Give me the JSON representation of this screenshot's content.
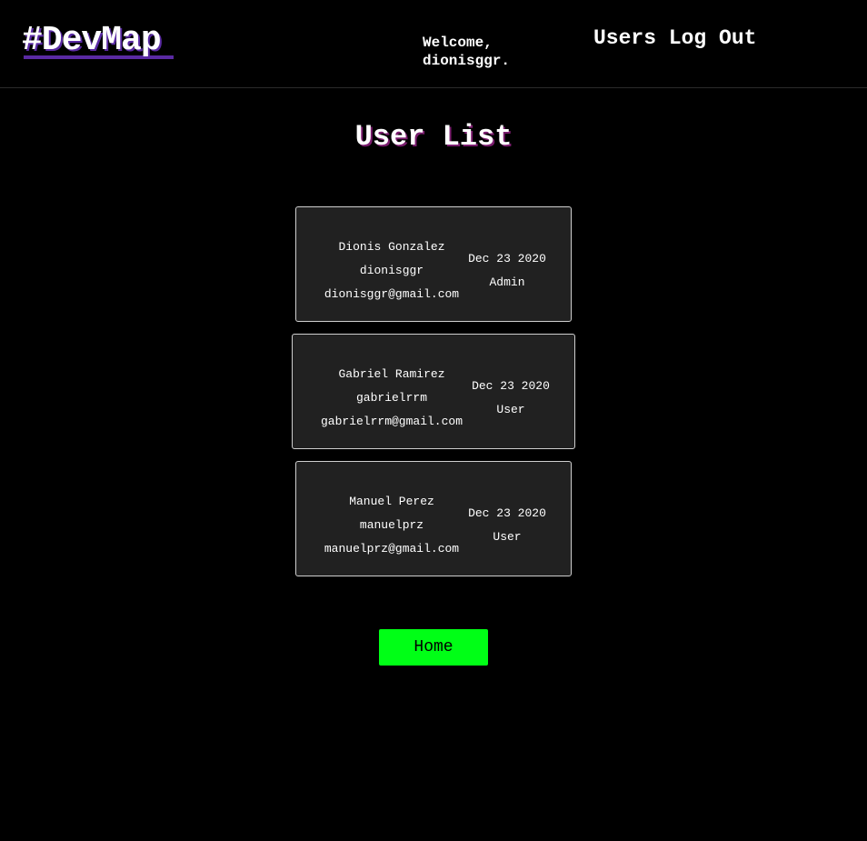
{
  "header": {
    "brand": "#DevMap",
    "welcome_line1": "Welcome,",
    "welcome_line2": "dionisggr.",
    "nav_users": "Users",
    "nav_logout": "Log Out"
  },
  "main": {
    "title": "User List",
    "users": [
      {
        "name": "Dionis Gonzalez",
        "username": "dionisggr",
        "email": "dionisggr@gmail.com",
        "date": "Dec 23 2020",
        "role": "Admin"
      },
      {
        "name": "Gabriel Ramirez",
        "username": "gabrielrrm",
        "email": "gabrielrrm@gmail.com",
        "date": "Dec 23 2020",
        "role": "User"
      },
      {
        "name": "Manuel Perez",
        "username": "manuelprz",
        "email": "manuelprz@gmail.com",
        "date": "Dec 23 2020",
        "role": "User"
      }
    ],
    "home_button": "Home"
  },
  "colors": {
    "background": "#000000",
    "card_background": "#212121",
    "accent_purple": "#5a2aa3",
    "home_button": "#00ff16"
  }
}
